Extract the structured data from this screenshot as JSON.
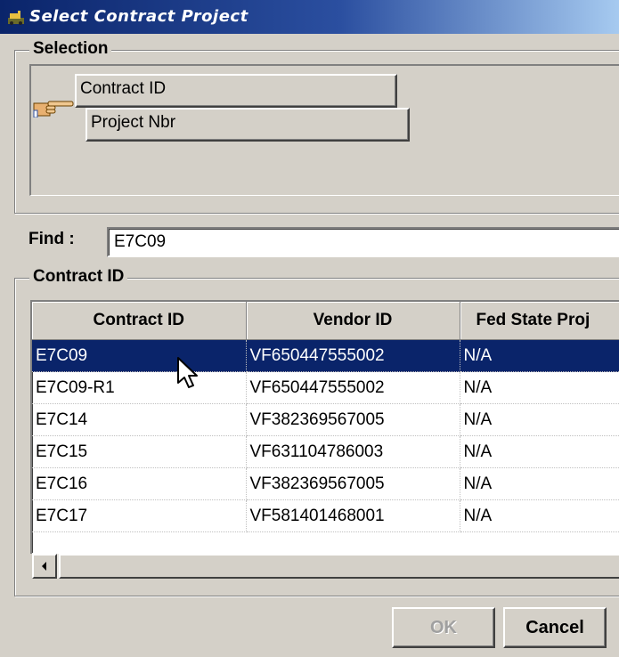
{
  "window": {
    "title": "Select Contract Project",
    "icon": "app-icon"
  },
  "selection": {
    "legend": "Selection",
    "sort_buttons": [
      "Contract ID",
      "Project Nbr"
    ],
    "pointer_icon": "hand-pointer-icon"
  },
  "find": {
    "label": "Find :",
    "value": "E7C09"
  },
  "results": {
    "legend": "Contract ID",
    "columns": [
      "Contract ID",
      "Vendor ID",
      "Fed State Proj"
    ],
    "rows": [
      [
        "E7C09",
        "VF650447555002",
        "N/A"
      ],
      [
        "E7C09-R1",
        "VF650447555002",
        "N/A"
      ],
      [
        "E7C14",
        "VF382369567005",
        "N/A"
      ],
      [
        "E7C15",
        "VF631104786003",
        "N/A"
      ],
      [
        "E7C16",
        "VF382369567005",
        "N/A"
      ],
      [
        "E7C17",
        "VF581401468001",
        "N/A"
      ]
    ],
    "selected_row": 0
  },
  "buttons": {
    "ok": "OK",
    "cancel": "Cancel"
  },
  "colors": {
    "titlebar": "#0a246a",
    "selection": "#0a246a",
    "face": "#d4d0c8"
  }
}
